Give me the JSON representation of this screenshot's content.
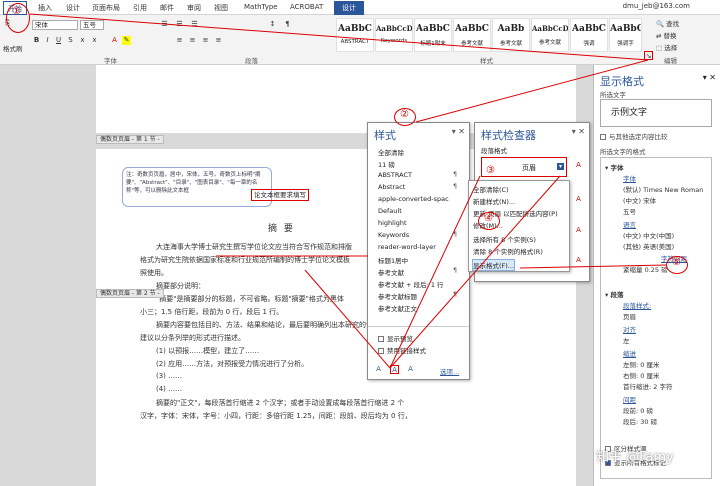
{
  "tabs": [
    "开始",
    "插入",
    "设计",
    "页面布局",
    "引用",
    "邮件",
    "审阅",
    "视图",
    "MathType",
    "ACROBAT",
    "设计"
  ],
  "user": "dmu_jeb@163.com",
  "ribbon": {
    "font_name": "宋体",
    "font_size": "五号",
    "groups": [
      "字体",
      "段落",
      "样式",
      "编辑"
    ],
    "clipboard": "格式刷",
    "edit": [
      "查找",
      "替换",
      "选择"
    ],
    "styles": [
      {
        "sample": "AaBbC",
        "name": "ABSTRACT"
      },
      {
        "sample": "AaBbCcD",
        "name": "Keywords"
      },
      {
        "sample": "AaBbC",
        "name": "标题1附末"
      },
      {
        "sample": "AaBbC",
        "name": "参考文献"
      },
      {
        "sample": "AaBb",
        "name": "参考文献"
      },
      {
        "sample": "AaBbCcD",
        "name": "参考文献"
      },
      {
        "sample": "AaBbC",
        "name": "强调"
      },
      {
        "sample": "AaBbC",
        "name": "强调字"
      }
    ]
  },
  "document": {
    "header1": "偶数页页眉 - 第 1 节 -",
    "header2": "偶数页页眉 - 第 2 节 -",
    "note": "注：奇数页页眉，居中，宋体，五号。奇数页上标明\"摘要\"、\"Abstract\"、\"目录\"、\"图表目录\"、\"每一章的名称\"等，可以删除此文本框",
    "textbox": "论文本框要求填写",
    "heading": "摘   要",
    "para": [
      "大连海事大学博士研究生撰写学位论文应当符合写作规范和排版",
      "格式为研究生院依据国家标准和行业规范所编制的博士学位论文模板",
      "照使用。",
      "摘要部分说明：",
      "\"摘要\"是摘要部分的标题，不可省略。标题\"摘要\"格式为黑体",
      "小三；1.5 倍行距，段前为 0 行，段后 1 行。",
      "摘要内容要包括目的、方法、结果和结论，最后要明确列出本研究的创新性成果。",
      "建议以分条列举的形式进行描述。",
      "(1) 以预报……模型，建立了……",
      "(2) 应用……方法，对预报受力情况进行了分析。",
      "(3) ……",
      "(4) ……",
      "摘要的\"正文\"，每段落首行缩进 2 个汉字；或者手动设置成每段落首行缩进 2 个",
      "汉字，字体：宋体，字号：小四，行距：多倍行距 1.25，间距：段前、段后均为 0 行，"
    ]
  },
  "styles_pane": {
    "title": "样式",
    "items": [
      "全部清除",
      "11 磅",
      "ABSTRACT",
      "Abstract",
      "apple-converted-spac",
      "Default",
      "highlight",
      "Keywords",
      "reader-word-layer",
      "标题1居中",
      "参考文献",
      "参考文献 + 段后: 1 行",
      "参考文献标题",
      "参考文献正文"
    ],
    "checkbox1": "显示预览",
    "checkbox2": "禁用链接样式",
    "options": "选项..."
  },
  "inspector_pane": {
    "title": "样式检查器",
    "para_label": "段落格式",
    "current": "页眉",
    "menu": [
      "全部清除(C)",
      "新建样式(N)...",
      "更新 页眉 以匹配所选内容(P)",
      "修改(M)...",
      "选择所有 8 个实例(S)",
      "清除 8 个实例的格式(R)",
      "显示格式(F)..."
    ]
  },
  "reveal_pane": {
    "title": "显示格式",
    "selected_label": "所选文字",
    "sample": "示例文字",
    "compare": "与其他选定内容比较",
    "formatting_label": "所选文字的格式",
    "font_header": "字体",
    "font_link": "字体",
    "font_rows": [
      "(默认) Times New Roman",
      "(中文) 宋体",
      "五号"
    ],
    "lang_link": "语言",
    "lang_rows": [
      "(中文) 中文(中国)",
      "(其他) 英语(美国)"
    ],
    "spacing_link": "字符间距",
    "spacing_row": "紧缩量 0.25 磅",
    "para_header": "段落",
    "para_style_link": "段落样式:",
    "para_style": "页眉",
    "align_link": "对齐",
    "align": "左",
    "indent_link": "缩进",
    "indent_rows": [
      "左侧: 0 厘米",
      "右侧: 0 厘米",
      "首行缩进: 2 字符"
    ],
    "spacing2_link": "间距",
    "spacing2_rows": [
      "段前: 0 磅",
      "段后: 30 磅"
    ],
    "distinguish": "区分样式源",
    "show_all": "显示所有格式标记"
  },
  "annotations": [
    "①",
    "②",
    "③",
    "④",
    "⑤"
  ],
  "watermark": "知乎 @Famy"
}
